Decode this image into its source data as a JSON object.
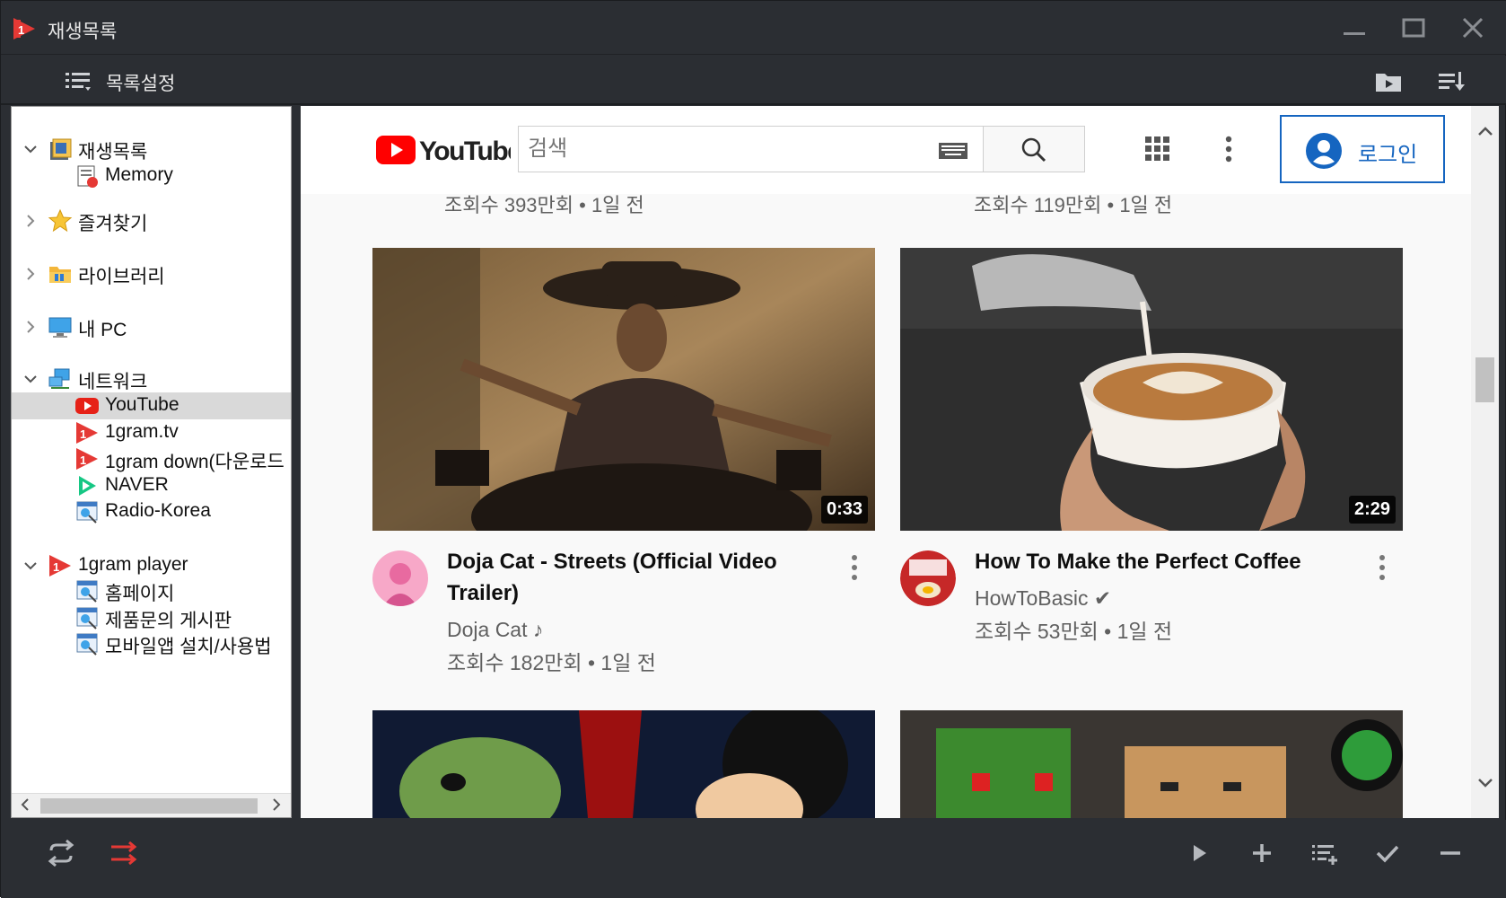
{
  "window": {
    "title": "재생목록",
    "minimize_glyph": "—",
    "maximize_glyph": "☐",
    "close_glyph": "✕"
  },
  "toolbar": {
    "list_settings_label": "목록설정",
    "left_icon": "list-settings-icon",
    "right_icons": [
      "play-folder-icon",
      "sort-list-icon"
    ]
  },
  "sidebar": {
    "items": [
      {
        "label": "재생목록",
        "icon": "playlist-folder-icon",
        "level": 0,
        "expanded": true
      },
      {
        "label": "Memory",
        "icon": "memory-icon",
        "level": 1
      },
      {
        "label": "즐겨찾기",
        "icon": "star-icon",
        "level": 0,
        "expanded": false
      },
      {
        "label": "라이브러리",
        "icon": "library-folder-icon",
        "level": 0,
        "expanded": false
      },
      {
        "label": "내 PC",
        "icon": "computer-icon",
        "level": 0,
        "expanded": false
      },
      {
        "label": "네트워크",
        "icon": "network-icon",
        "level": 0,
        "expanded": true
      },
      {
        "label": "YouTube",
        "icon": "youtube-icon",
        "level": 1,
        "selected": true
      },
      {
        "label": "1gram.tv",
        "icon": "1gram-icon",
        "level": 1
      },
      {
        "label": "1gram down(다운로드",
        "icon": "1gram-icon",
        "level": 1
      },
      {
        "label": "NAVER",
        "icon": "naver-play-icon",
        "level": 1
      },
      {
        "label": "Radio-Korea",
        "icon": "web-link-icon",
        "level": 1
      },
      {
        "label": "1gram player",
        "icon": "1gram-icon",
        "level": 0,
        "expanded": true
      },
      {
        "label": "홈페이지",
        "icon": "web-link-icon",
        "level": 1
      },
      {
        "label": "제품문의 게시판",
        "icon": "web-link-icon",
        "level": 1
      },
      {
        "label": "모바일앱 설치/사용법",
        "icon": "web-link-icon",
        "level": 1
      }
    ]
  },
  "youtube": {
    "logo_text": "YouTube",
    "search_placeholder": "검색",
    "login_label": "로그인",
    "top_row_views": [
      "조회수 393만회 • 1일 전",
      "조회수 119만회 • 1일 전"
    ],
    "videos": [
      {
        "title": "Doja Cat - Streets (Official Video Trailer)",
        "channel": "Doja Cat ♪",
        "views": "조회수 182만회 • 1일 전",
        "duration": "0:33"
      },
      {
        "title": "How To Make the Perfect Coffee",
        "channel": "HowToBasic ✔",
        "views": "조회수 53만회 • 1일 전",
        "duration": "2:29"
      }
    ]
  },
  "bottombar": {
    "left_icons": [
      "repeat-icon",
      "shuffle-icon"
    ],
    "right_icons": [
      "play-icon",
      "add-icon",
      "add-to-list-icon",
      "check-icon",
      "remove-icon"
    ]
  },
  "colors": {
    "chrome_bg": "#2b2e33",
    "accent_red": "#e53935",
    "youtube_red": "#ff0000",
    "login_blue": "#1565c0"
  }
}
